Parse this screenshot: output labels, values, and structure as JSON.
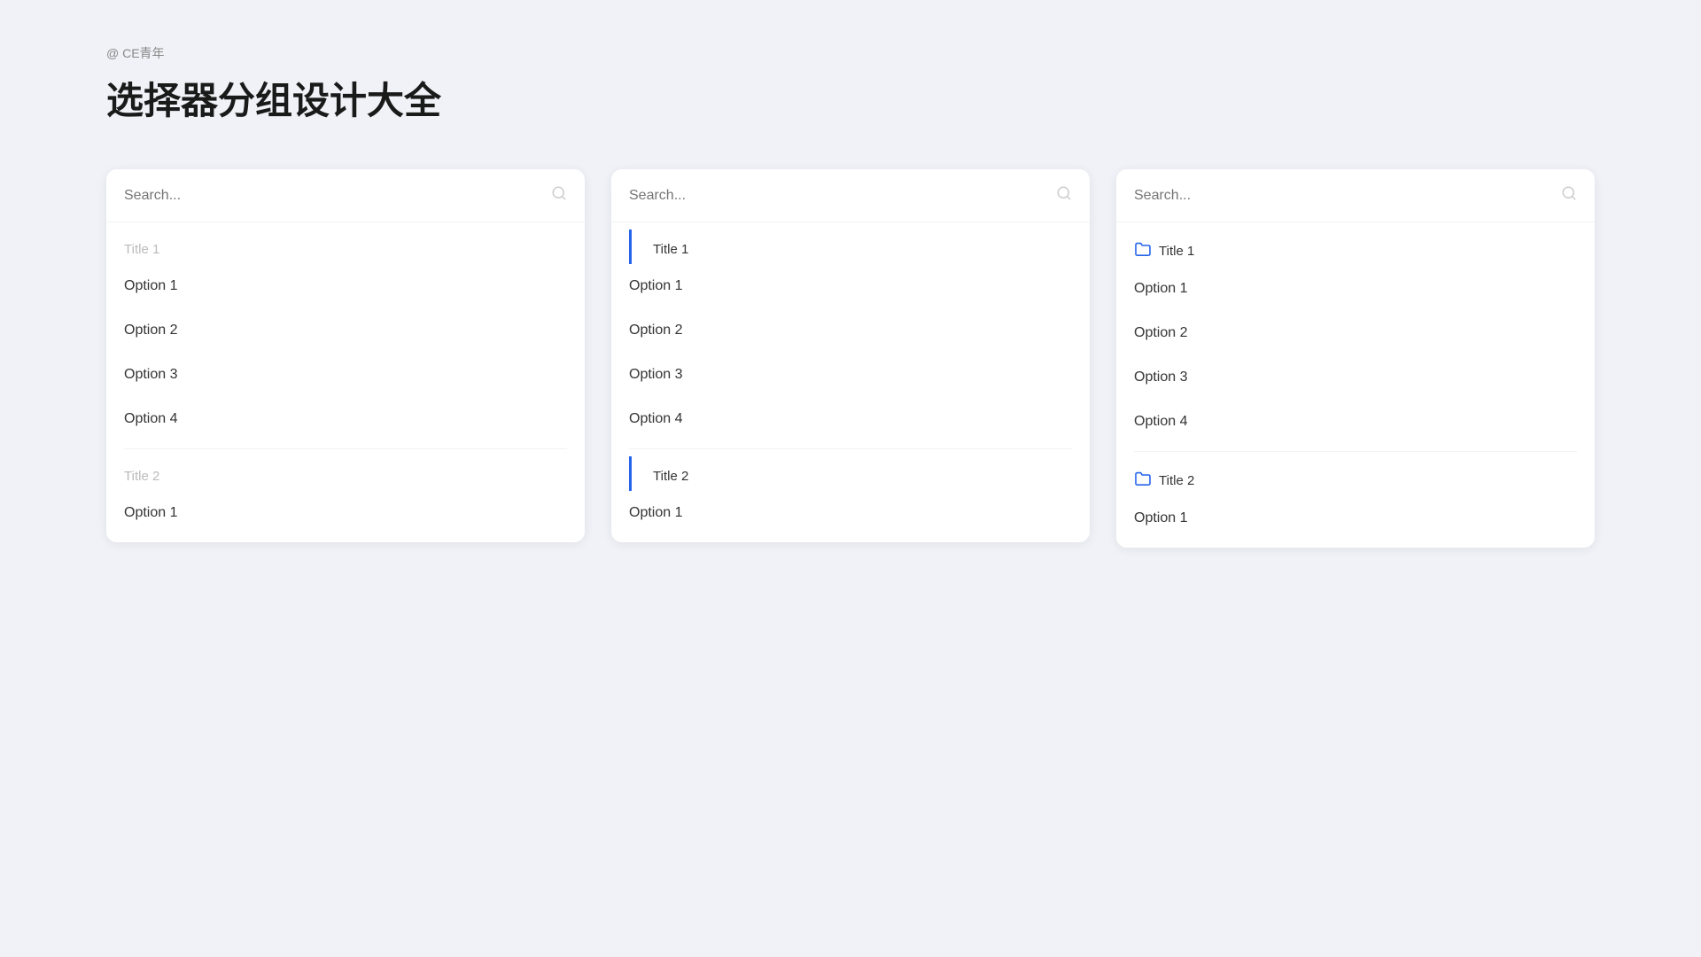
{
  "brand": "@ CE青年",
  "title": "选择器分组设计大全",
  "cards": [
    {
      "id": "card-1",
      "search_placeholder": "Search...",
      "groups": [
        {
          "title_type": "plain",
          "title": "Title 1",
          "options": [
            "Option 1",
            "Option 2",
            "Option 3",
            "Option 4"
          ]
        },
        {
          "title_type": "plain",
          "title": "Title 2",
          "options": [
            "Option 1"
          ]
        }
      ]
    },
    {
      "id": "card-2",
      "search_placeholder": "Search...",
      "groups": [
        {
          "title_type": "bar",
          "title": "Title 1",
          "options": [
            "Option 1",
            "Option 2",
            "Option 3",
            "Option 4"
          ]
        },
        {
          "title_type": "bar",
          "title": "Title 2",
          "options": [
            "Option 1"
          ]
        }
      ]
    },
    {
      "id": "card-3",
      "search_placeholder": "Search...",
      "groups": [
        {
          "title_type": "folder",
          "title": "Title 1",
          "options": [
            "Option 1",
            "Option 2",
            "Option 3",
            "Option 4"
          ]
        },
        {
          "title_type": "folder",
          "title": "Title 2",
          "options": [
            "Option 1"
          ]
        }
      ]
    }
  ]
}
